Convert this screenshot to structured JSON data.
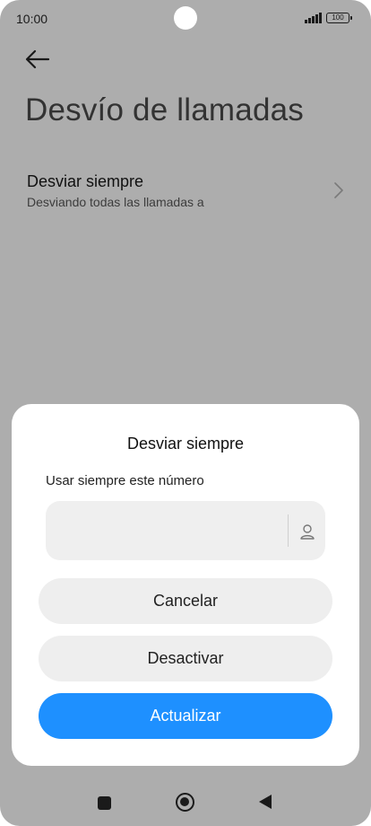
{
  "status_bar": {
    "time": "10:00",
    "battery": "100"
  },
  "header": {
    "title": "Desvío de llamadas"
  },
  "setting": {
    "title": "Desviar siempre",
    "subtitle": "Desviando todas las llamadas a"
  },
  "dialog": {
    "title": "Desviar siempre",
    "field_label": "Usar siempre este número",
    "input_value": "",
    "cancel_label": "Cancelar",
    "deactivate_label": "Desactivar",
    "update_label": "Actualizar"
  },
  "colors": {
    "backdrop": "#adadad",
    "accent": "#1e90ff",
    "button_secondary": "#eeeeee"
  },
  "icons": {
    "back": "arrow-left-icon",
    "chevron": "chevron-right-icon",
    "contact": "contact-person-icon"
  }
}
